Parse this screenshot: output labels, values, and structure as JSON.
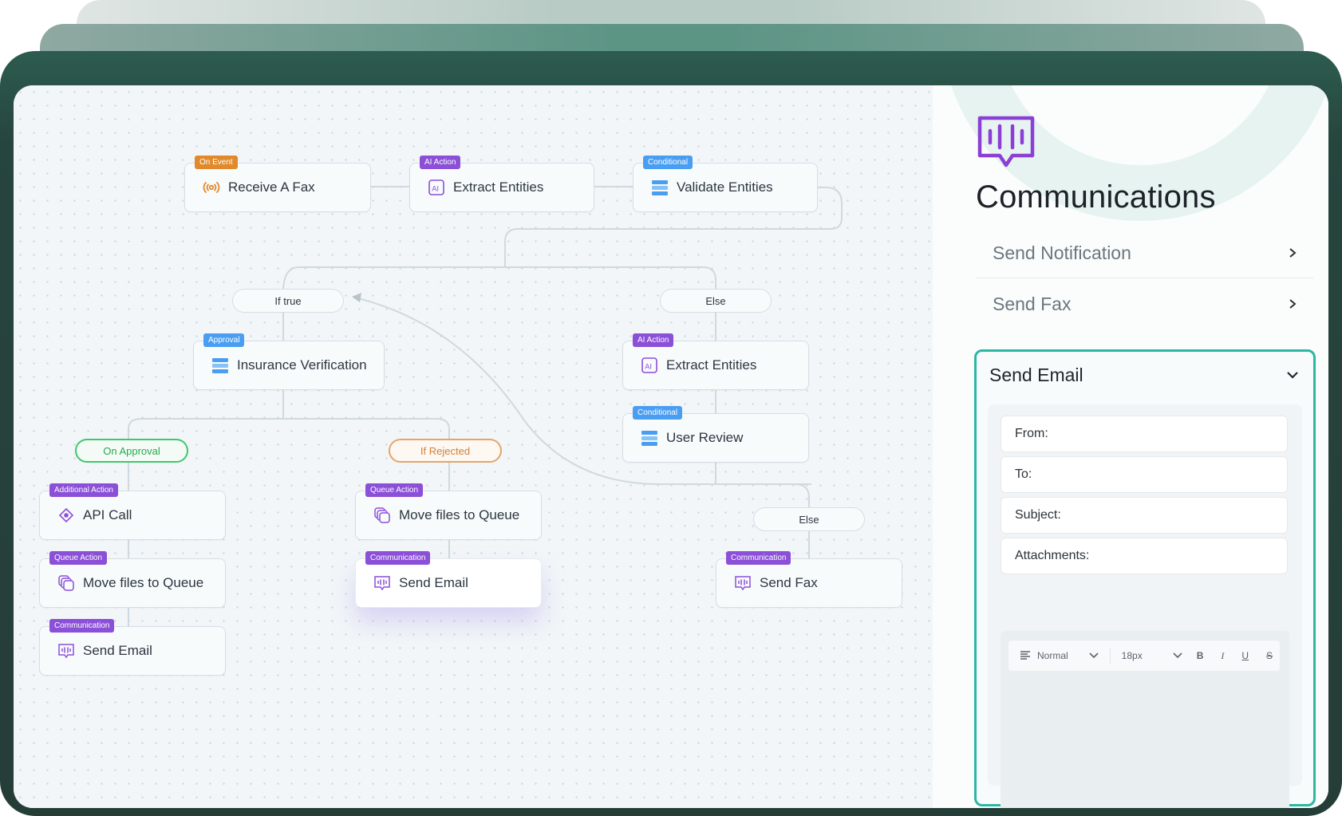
{
  "workflow": {
    "nodes": [
      {
        "id": "receive-fax",
        "tag": "On Event",
        "tagColor": "#e08a2c",
        "label": "Receive A Fax",
        "icon": "broadcast-icon"
      },
      {
        "id": "extract-1",
        "tag": "AI Action",
        "tagColor": "#8b4fd8",
        "label": "Extract Entities",
        "icon": "ai-icon"
      },
      {
        "id": "validate",
        "tag": "Conditional",
        "tagColor": "#4a9ef2",
        "label": "Validate Entities",
        "icon": "conditional-icon"
      },
      {
        "id": "insurance",
        "tag": "Approval",
        "tagColor": "#4a9ef2",
        "label": "Insurance Verification",
        "icon": "conditional-icon"
      },
      {
        "id": "extract-2",
        "tag": "AI Action",
        "tagColor": "#8b4fd8",
        "label": "Extract Entities",
        "icon": "ai-icon"
      },
      {
        "id": "user-review",
        "tag": "Conditional",
        "tagColor": "#4a9ef2",
        "label": "User Review",
        "icon": "conditional-icon"
      },
      {
        "id": "api-call",
        "tag": "Additional Action",
        "tagColor": "#8b4fd8",
        "label": "API Call",
        "icon": "api-icon"
      },
      {
        "id": "move-left",
        "tag": "Queue Action",
        "tagColor": "#8b4fd8",
        "label": "Move files to Queue",
        "icon": "queue-icon"
      },
      {
        "id": "email-left",
        "tag": "Communication",
        "tagColor": "#8b4fd8",
        "label": "Send Email",
        "icon": "communication-icon"
      },
      {
        "id": "move-mid",
        "tag": "Queue Action",
        "tagColor": "#8b4fd8",
        "label": "Move files to Queue",
        "icon": "queue-icon"
      },
      {
        "id": "email-mid",
        "tag": "Communication",
        "tagColor": "#8b4fd8",
        "label": "Send Email",
        "icon": "communication-icon"
      },
      {
        "id": "send-fax",
        "tag": "Communication",
        "tagColor": "#8b4fd8",
        "label": "Send Fax",
        "icon": "communication-icon"
      }
    ],
    "branches": {
      "if_true": "If true",
      "else_1": "Else",
      "on_approval": "On Approval",
      "if_rejected": "If Rejected",
      "else_2": "Else"
    },
    "colors": {
      "accent_teal": "#2bb7a2",
      "approval_green": "#3ec86b",
      "rejected_amber": "#e4a667",
      "brand_purple": "#8b4fd8"
    }
  },
  "panel": {
    "logo_icon": "communication-icon",
    "title": "Communications",
    "items": [
      {
        "label": "Send Notification",
        "icon": "chevron-right-icon"
      },
      {
        "label": "Send Fax",
        "icon": "chevron-right-icon"
      }
    ],
    "expanded": {
      "label": "Send Email",
      "icon": "chevron-down-icon",
      "fields": [
        "From:",
        "To:",
        "Subject:",
        "Attachments:"
      ],
      "toolbar": {
        "style_value": "Normal",
        "size_value": "18px",
        "bold": "B",
        "italic": "I",
        "underline": "U",
        "strike": "S"
      }
    }
  }
}
